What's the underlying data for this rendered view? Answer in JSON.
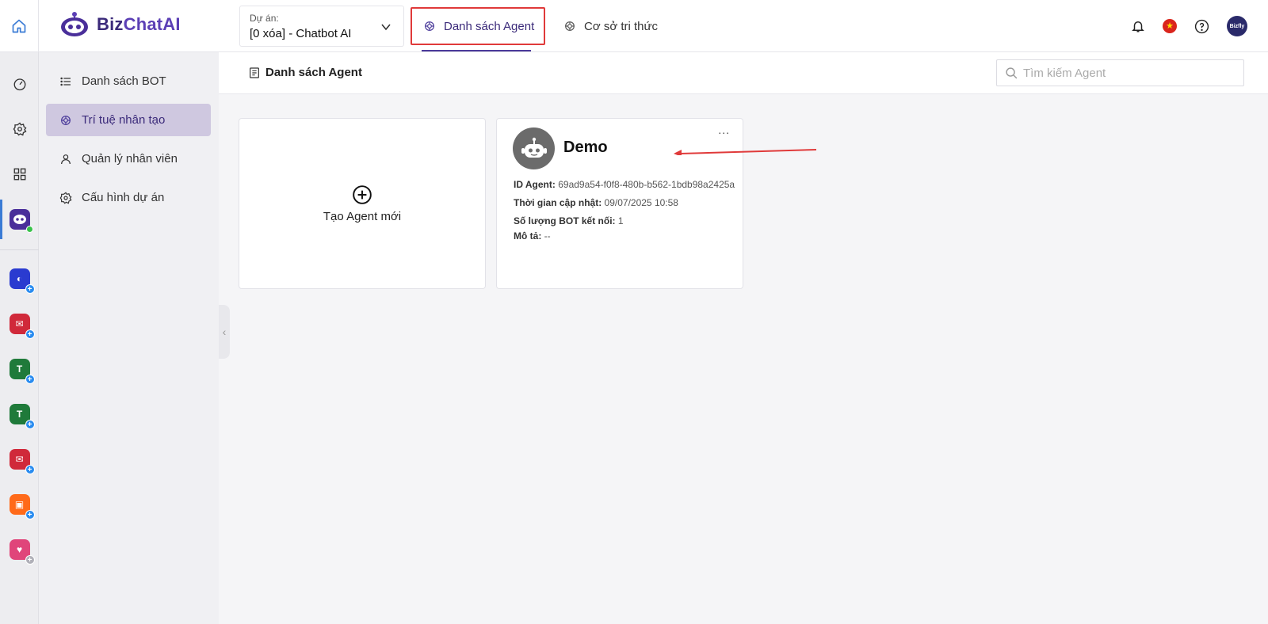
{
  "brand": {
    "name_part1": "Biz",
    "name_part2": "ChatAI"
  },
  "project": {
    "label": "Dự án:",
    "value": "[0 xóa] - Chatbot AI"
  },
  "tabs": [
    {
      "label": "Danh sách Agent",
      "active": true
    },
    {
      "label": "Cơ sở tri thức",
      "active": false
    }
  ],
  "header_icons": [
    "bell-icon",
    "vietnam-flag-icon",
    "help-icon",
    "user-avatar"
  ],
  "user_avatar_text": "Bizfly",
  "rail": {
    "top_items": [
      "dashboard-icon",
      "settings-icon",
      "apps-grid-icon",
      "bizchatai-app-icon"
    ],
    "apps": [
      {
        "name": "app-blue",
        "color": "#2a3bd0",
        "badge": "+"
      },
      {
        "name": "app-mail-red",
        "color": "#d0293a",
        "badge": "+"
      },
      {
        "name": "app-green-1",
        "color": "#1f7a3a",
        "badge": "+"
      },
      {
        "name": "app-green-2",
        "color": "#1f7a3a",
        "badge": "+"
      },
      {
        "name": "app-mail-red-2",
        "color": "#d0293a",
        "badge": "+"
      },
      {
        "name": "app-orange",
        "color": "#ff6a1a",
        "badge": "+"
      },
      {
        "name": "app-pink",
        "color": "#e0457a",
        "badge": "+"
      }
    ]
  },
  "sidebar": {
    "items": [
      {
        "label": "Danh sách BOT",
        "icon": "list-icon"
      },
      {
        "label": "Trí tuệ nhân tạo",
        "icon": "ai-icon",
        "active": true
      },
      {
        "label": "Quản lý nhân viên",
        "icon": "user-icon"
      },
      {
        "label": "Cấu hình dự án",
        "icon": "gear-icon"
      }
    ]
  },
  "page": {
    "title": "Danh sách Agent",
    "search_placeholder": "Tìm kiếm Agent"
  },
  "create_card": {
    "label": "Tạo Agent mới"
  },
  "agent_card": {
    "name": "Demo",
    "more": "...",
    "id_label": "ID Agent:",
    "id_value": "69ad9a54-f0f8-480b-b562-1bdb98a2425a",
    "updated_label": "Thời gian cập nhật:",
    "updated_value": "09/07/2025 10:58",
    "bots_label": "Số lượng BOT kết nối:",
    "bots_value": "1",
    "desc_label": "Mô tả:",
    "desc_value": "--"
  },
  "colors": {
    "accent": "#3b2a7a",
    "active_tab_border": "#e03a3a",
    "annotation_arrow": "#e03a3a"
  }
}
